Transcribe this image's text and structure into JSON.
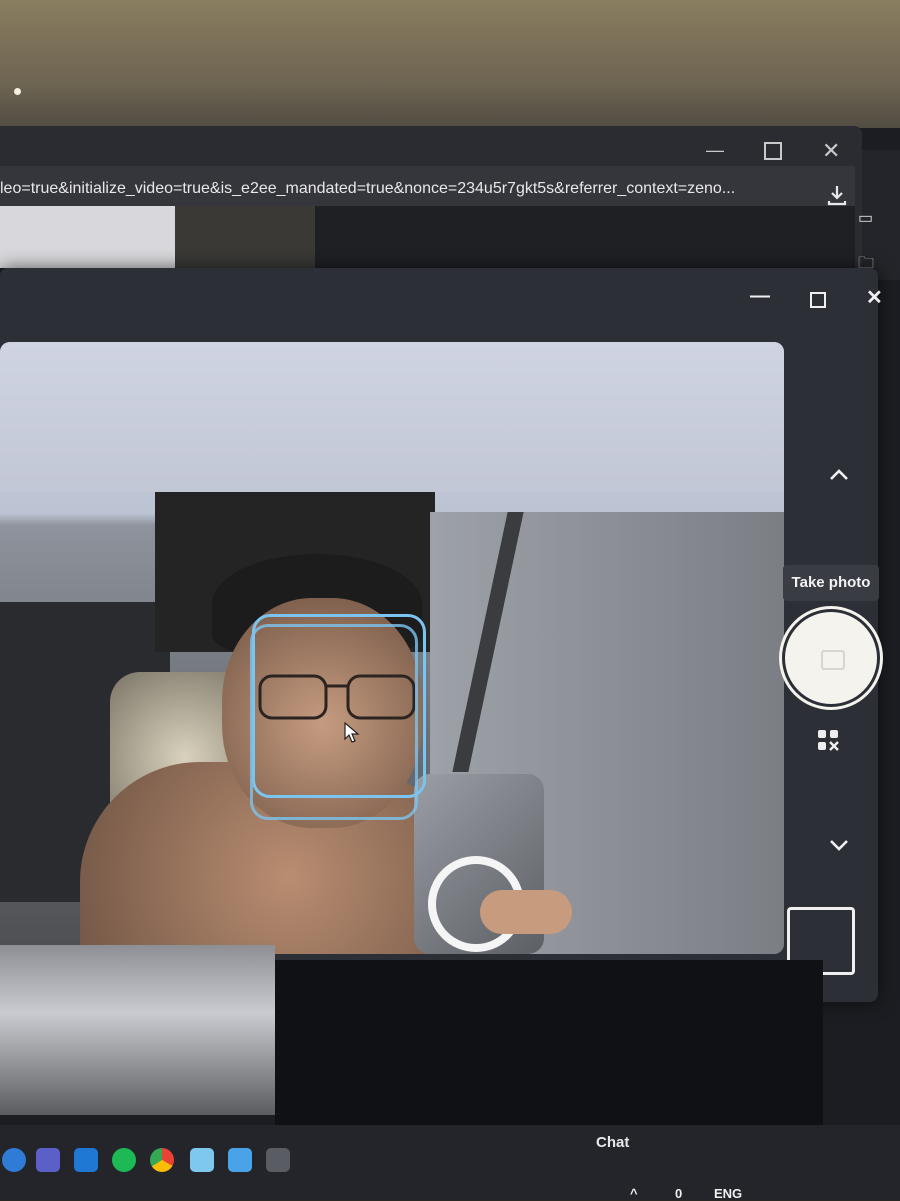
{
  "browser": {
    "url": "leo=true&initialize_video=true&is_e2ee_mandated=true&nonce=234u5r7gkt5s&referrer_context=zeno...",
    "icons": [
      "minimize-icon",
      "maximize-icon",
      "close-icon",
      "download-icon"
    ]
  },
  "camera": {
    "controls": [
      "minimize-icon",
      "maximize-icon",
      "close-icon"
    ],
    "take_photo_label": "Take photo",
    "icons": [
      "chevron-up-icon",
      "shutter-button",
      "qr-mode-icon",
      "chevron-down-icon",
      "gallery-thumbnail"
    ],
    "accent_color": "#7cc4f0"
  },
  "lower": {
    "chat_label": "Chat"
  },
  "taskbar": {
    "icons": [
      "teams-icon",
      "outlook-icon",
      "spotify-icon",
      "chrome-icon",
      "files-icon",
      "store-icon",
      "camera-icon"
    ],
    "tray_count": "0",
    "language": "ENG"
  }
}
